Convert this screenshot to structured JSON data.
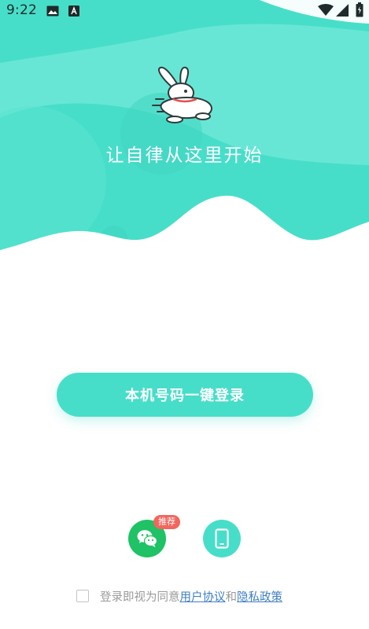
{
  "status_bar": {
    "time": "9:22",
    "icons": [
      "gallery-icon",
      "a-icon",
      "wifi-icon",
      "signal-icon",
      "battery-icon"
    ]
  },
  "hero": {
    "slogan": "让自律从这里开始",
    "logo": "rabbit-logo-icon",
    "colors": {
      "primary": "#47dec9",
      "light": "#6ee8d7"
    }
  },
  "login": {
    "one_click_label": "本机号码一键登录"
  },
  "alt_login": {
    "wechat_icon": "wechat-icon",
    "recommend_badge": "推荐",
    "phone_icon": "phone-icon"
  },
  "agreement": {
    "prefix": "登录即视为同意",
    "user_agreement": "用户协议",
    "conjunction": "和",
    "privacy_policy": "隐私政策"
  },
  "colors": {
    "accent": "#47dec9",
    "wechat": "#1fc265",
    "badge": "#f2665e",
    "link": "#3f7ec4",
    "muted_text": "#9a9a9a"
  }
}
